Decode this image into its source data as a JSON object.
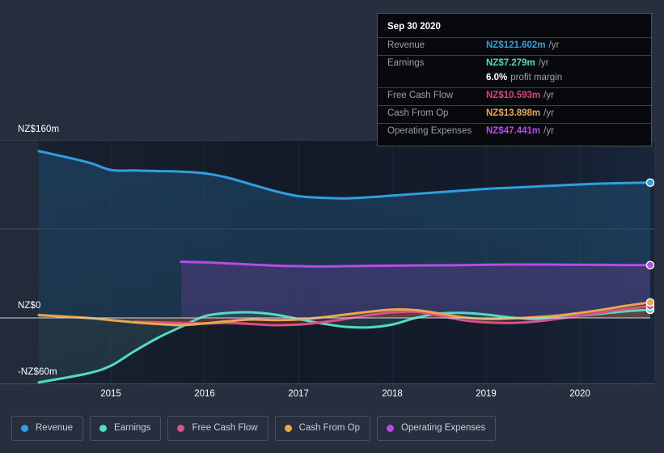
{
  "axis": {
    "y_labels": [
      "NZ$160m",
      "NZ$0",
      "-NZ$60m"
    ],
    "x_labels": [
      "2015",
      "2016",
      "2017",
      "2018",
      "2019",
      "2020"
    ]
  },
  "tooltip": {
    "title": "Sep 30 2020",
    "rows": [
      {
        "key": "Revenue",
        "value": "NZ$121.602m",
        "unit": "/yr",
        "color": "#2f9fe0"
      },
      {
        "key": "Earnings",
        "value": "NZ$7.279m",
        "unit": "/yr",
        "color": "#4fdcc0"
      },
      {
        "key": "",
        "value": "6.0%",
        "unit": "profit margin",
        "color": "#ffffff"
      },
      {
        "key": "Free Cash Flow",
        "value": "NZ$10.593m",
        "unit": "/yr",
        "color": "#e0417f"
      },
      {
        "key": "Cash From Op",
        "value": "NZ$13.898m",
        "unit": "/yr",
        "color": "#e8a84c"
      },
      {
        "key": "Operating Expenses",
        "value": "NZ$47.441m",
        "unit": "/yr",
        "color": "#b44ce8"
      }
    ]
  },
  "legend": {
    "items": [
      {
        "label": "Revenue",
        "color": "#2f9fe0"
      },
      {
        "label": "Earnings",
        "color": "#4fdcc0"
      },
      {
        "label": "Free Cash Flow",
        "color": "#d94f8a"
      },
      {
        "label": "Cash From Op",
        "color": "#e8a84c"
      },
      {
        "label": "Operating Expenses",
        "color": "#b44ce8"
      }
    ]
  },
  "chart_data": {
    "type": "area",
    "title": "",
    "xlabel": "",
    "ylabel": "NZ$",
    "currency": "NZ$",
    "units": "millions per year",
    "ylim": [
      -60,
      160
    ],
    "y_ticks": [
      160,
      80,
      0,
      -60
    ],
    "grid": true,
    "legend_position": "bottom",
    "x": [
      2014.45,
      2014.75,
      2015.0,
      2015.25,
      2015.5,
      2015.75,
      2016.0,
      2016.25,
      2016.5,
      2016.75,
      2017.0,
      2017.25,
      2017.5,
      2017.75,
      2018.0,
      2018.25,
      2018.5,
      2018.75,
      2019.0,
      2019.25,
      2019.5,
      2019.75,
      2020.0,
      2020.25,
      2020.5,
      2020.75
    ],
    "x_tick_values": [
      2015,
      2016,
      2017,
      2018,
      2019,
      2020
    ],
    "series": [
      {
        "name": "Revenue",
        "color": "#2f9fe0",
        "fill": "#1f4a6b",
        "values": [
          150.0,
          140.0,
          133.0,
          132.5,
          132.0,
          131.5,
          130.0,
          126.0,
          120.0,
          114.0,
          109.5,
          108.0,
          107.5,
          108.5,
          110.0,
          111.5,
          113.0,
          114.5,
          116.0,
          117.0,
          118.0,
          119.0,
          120.0,
          120.8,
          121.3,
          121.602
        ]
      },
      {
        "name": "Earnings",
        "color": "#4fdcc0",
        "fill": "#2e4f5a",
        "values": [
          -58.0,
          -50.0,
          -43.0,
          -30.0,
          -18.0,
          -8.0,
          1.5,
          4.5,
          5.0,
          3.0,
          -1.0,
          -5.0,
          -8.0,
          -8.5,
          -6.0,
          0.0,
          4.0,
          4.5,
          3.0,
          0.5,
          -1.0,
          0.0,
          2.0,
          4.0,
          6.0,
          7.279
        ]
      },
      {
        "name": "Free Cash Flow",
        "color": "#d94f8a",
        "fill": "#6b2a3e",
        "values": [
          null,
          null,
          null,
          -3.5,
          -4.0,
          -4.5,
          -5.0,
          -4.5,
          -5.5,
          -6.5,
          -6.0,
          -4.0,
          -1.0,
          2.5,
          5.0,
          5.5,
          2.0,
          -2.0,
          -4.0,
          -4.5,
          -3.5,
          -1.0,
          2.0,
          5.0,
          8.0,
          10.593
        ]
      },
      {
        "name": "Cash From Op",
        "color": "#e8a84c",
        "fill": "#6b5530",
        "values": [
          2.5,
          0.0,
          -2.0,
          -4.0,
          -5.5,
          -6.5,
          -5.0,
          -3.0,
          -1.5,
          -2.0,
          -1.5,
          0.5,
          3.0,
          5.5,
          7.5,
          7.0,
          4.0,
          0.5,
          -1.0,
          -0.5,
          0.5,
          2.0,
          4.5,
          7.5,
          11.0,
          13.898
        ]
      },
      {
        "name": "Operating Expenses",
        "color": "#b44ce8",
        "fill": "#4a3a78",
        "values": [
          null,
          null,
          null,
          null,
          null,
          50.5,
          50.0,
          49.0,
          48.0,
          47.0,
          46.5,
          46.3,
          46.5,
          46.8,
          47.0,
          47.2,
          47.3,
          47.5,
          47.8,
          48.0,
          48.0,
          47.9,
          47.8,
          47.7,
          47.5,
          47.441
        ]
      }
    ]
  }
}
